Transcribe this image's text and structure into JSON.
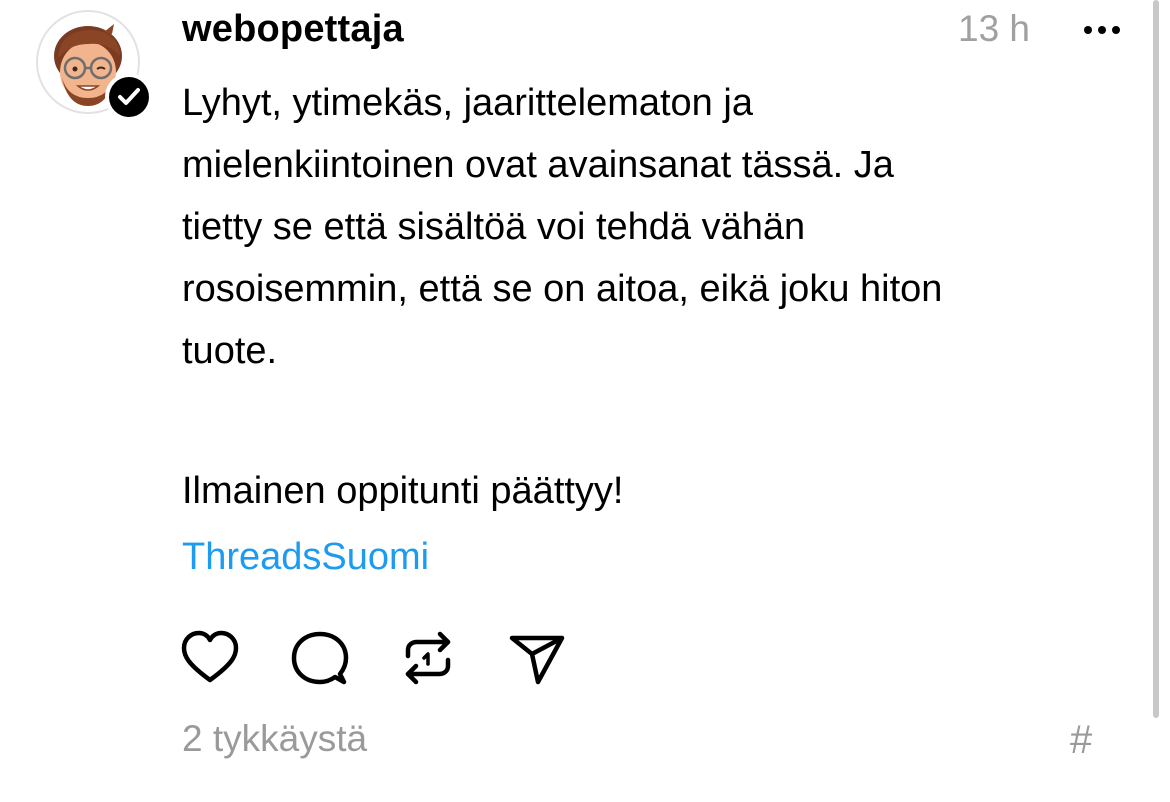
{
  "post": {
    "username": "webopettaja",
    "time": "13 h",
    "text": "Lyhyt, ytimekäs, jaarittelematon ja\nmielenkiintoinen ovat avainsanat tässä. Ja\ntietty se että sisältöä voi tehdä vähän\nrosoisemmin, että se on aitoa, eikä joku hiton\ntuote.",
    "text2": "Ilmainen oppitunti päättyy!",
    "tag": "ThreadsSuomi",
    "likes": "2 tykkäystä",
    "hash_symbol": "#"
  },
  "icons": {
    "like": "heart-icon",
    "comment": "comment-bubble-icon",
    "repost": "repost-icon",
    "share": "send-icon",
    "more": "more-dots-icon",
    "verified": "verified-check-icon"
  },
  "colors": {
    "link": "#1d9bf0",
    "muted": "#9a9a9a"
  }
}
